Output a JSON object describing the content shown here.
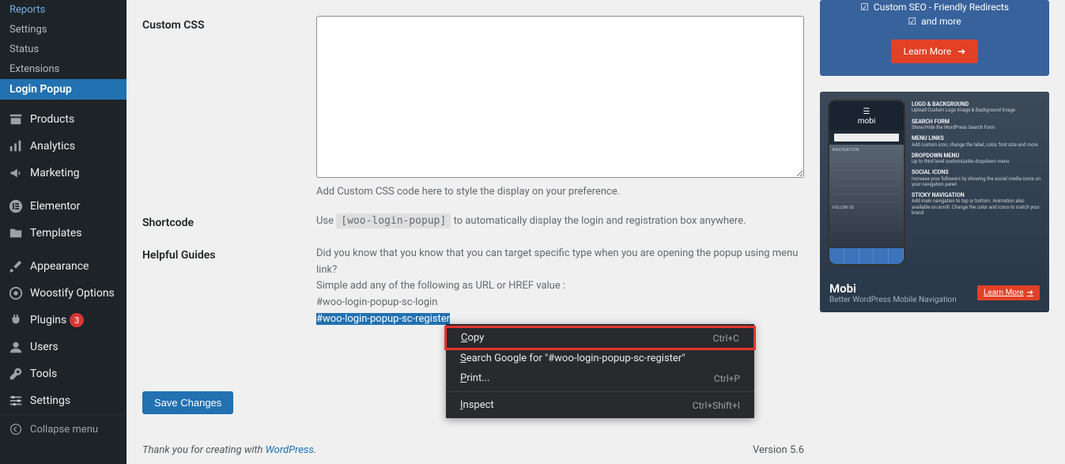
{
  "sidebar": {
    "submenu": [
      {
        "label": "Reports"
      },
      {
        "label": "Settings"
      },
      {
        "label": "Status"
      },
      {
        "label": "Extensions"
      },
      {
        "label": "Login Popup",
        "active": true
      }
    ],
    "items": [
      {
        "label": "Products",
        "icon": "products"
      },
      {
        "label": "Analytics",
        "icon": "analytics"
      },
      {
        "label": "Marketing",
        "icon": "marketing"
      },
      {
        "label": "Elementor",
        "icon": "elementor"
      },
      {
        "label": "Templates",
        "icon": "templates"
      },
      {
        "label": "Appearance",
        "icon": "appearance"
      },
      {
        "label": "Woostify Options",
        "icon": "woostify"
      },
      {
        "label": "Plugins",
        "icon": "plugins",
        "badge": "3"
      },
      {
        "label": "Users",
        "icon": "users"
      },
      {
        "label": "Tools",
        "icon": "tools"
      },
      {
        "label": "Settings",
        "icon": "settings"
      }
    ],
    "collapse": "Collapse menu"
  },
  "fields": {
    "custom_css": {
      "label": "Custom CSS",
      "value": "",
      "description": "Add Custom CSS code here to style the display on your preference."
    },
    "shortcode": {
      "label": "Shortcode",
      "before": "Use ",
      "code": "[woo-login-popup]",
      "after": " to automatically display the login and registration box anywhere."
    },
    "guides": {
      "label": "Helpful Guides",
      "line1": "Did you know that you know that you can target specific type when you are opening the popup using menu link?",
      "line2": "Simple add any of the following as URL or HREF value :",
      "login": "#woo-login-popup-sc-login",
      "register": "#woo-login-popup-sc-register"
    },
    "save": "Save Changes"
  },
  "context_menu": {
    "copy": "Copy",
    "copy_shortcut": "Ctrl+C",
    "search": "Search Google for \"#woo-login-popup-sc-register\"",
    "print": "Print...",
    "print_shortcut": "Ctrl+P",
    "inspect": "Inspect",
    "inspect_shortcut": "Ctrl+Shift+I"
  },
  "promo1": {
    "f1": "Custom SEO - Friendly Redirects",
    "f2": "and more",
    "button": "Learn More"
  },
  "promo2": {
    "brand": "mobi",
    "nav_label": "NAVIGATION",
    "follow_label": "FOLLOW US",
    "features": [
      {
        "title": "LOGO & BACKGROUND",
        "desc": "Upload Custom Logo Image & Background Image"
      },
      {
        "title": "SEARCH FORM",
        "desc": "Show/Hide the WordPress Search Form"
      },
      {
        "title": "MENU LINKS",
        "desc": "Add custom icon, change the label, color, font size and more"
      },
      {
        "title": "DROPDOWN MENU",
        "desc": "Up to third level customizable dropdown menu"
      },
      {
        "title": "SOCIAL ICONS",
        "desc": "Increase your followers by showing the social media icons on your navigation panel"
      },
      {
        "title": "STICKY NAVIGATION",
        "desc": "Add main navigation to top or bottom. Animation also available on scroll. Change the color and icons to match your brand"
      }
    ],
    "title": "Mobi",
    "subtitle": "Better WordPress Mobile Navigation",
    "button": "Learn More"
  },
  "footer": {
    "thanks_before": "Thank you for creating with ",
    "wp": "WordPress",
    "thanks_after": ".",
    "version": "Version 5.6"
  }
}
